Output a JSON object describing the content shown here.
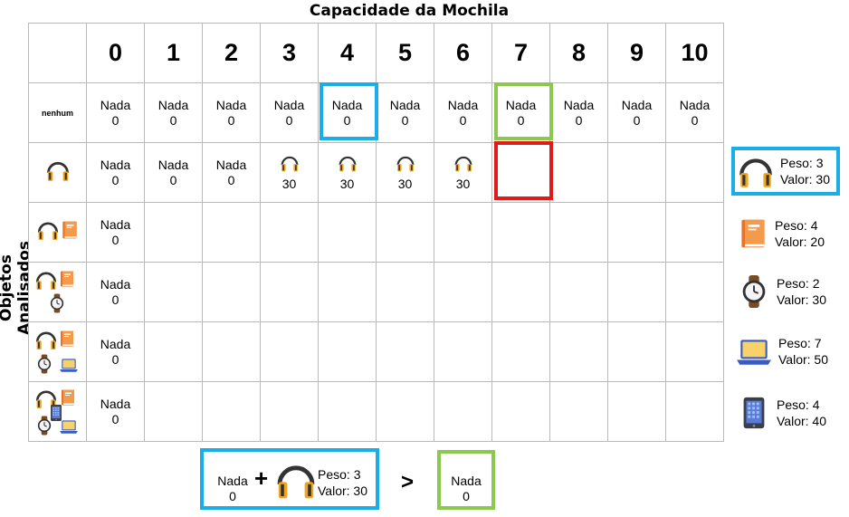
{
  "title": "Capacidade da Mochila",
  "y_axis_label": "Objetos Analisados",
  "capacities": [
    "0",
    "1",
    "2",
    "3",
    "4",
    "5",
    "6",
    "7",
    "8",
    "9",
    "10"
  ],
  "rows": [
    {
      "label": "nenhum",
      "cells": [
        {
          "text": "Nada",
          "value": "0"
        },
        {
          "text": "Nada",
          "value": "0"
        },
        {
          "text": "Nada",
          "value": "0"
        },
        {
          "text": "Nada",
          "value": "0"
        },
        {
          "text": "Nada",
          "value": "0"
        },
        {
          "text": "Nada",
          "value": "0"
        },
        {
          "text": "Nada",
          "value": "0"
        },
        {
          "text": "Nada",
          "value": "0"
        },
        {
          "text": "Nada",
          "value": "0"
        },
        {
          "text": "Nada",
          "value": "0"
        },
        {
          "text": "Nada",
          "value": "0"
        }
      ]
    },
    {
      "label": "",
      "cells": [
        {
          "text": "Nada",
          "value": "0"
        },
        {
          "text": "Nada",
          "value": "0"
        },
        {
          "text": "Nada",
          "value": "0"
        },
        {
          "icon": "headphones-icon",
          "value": "30"
        },
        {
          "icon": "headphones-icon",
          "value": "30"
        },
        {
          "icon": "headphones-icon",
          "value": "30"
        },
        {
          "icon": "headphones-icon",
          "value": "30"
        },
        {},
        {},
        {},
        {}
      ]
    },
    {
      "label": "",
      "cells": [
        {
          "text": "Nada",
          "value": "0"
        },
        {},
        {},
        {},
        {},
        {},
        {},
        {},
        {},
        {},
        {}
      ]
    },
    {
      "label": "",
      "cells": [
        {
          "text": "Nada",
          "value": "0"
        },
        {},
        {},
        {},
        {},
        {},
        {},
        {},
        {},
        {},
        {}
      ]
    },
    {
      "label": "",
      "cells": [
        {
          "text": "Nada",
          "value": "0"
        },
        {},
        {},
        {},
        {},
        {},
        {},
        {},
        {},
        {},
        {}
      ]
    },
    {
      "label": "",
      "cells": [
        {
          "text": "Nada",
          "value": "0"
        },
        {},
        {},
        {},
        {},
        {},
        {},
        {},
        {},
        {},
        {}
      ]
    }
  ],
  "items": [
    {
      "icon": "headphones-icon",
      "peso": "Peso: 3",
      "valor": "Valor: 30"
    },
    {
      "icon": "book-icon",
      "peso": "Peso: 4",
      "valor": "Valor: 20"
    },
    {
      "icon": "watch-icon",
      "peso": "Peso: 2",
      "valor": "Valor: 30"
    },
    {
      "icon": "laptop-icon",
      "peso": "Peso: 7",
      "valor": "Valor: 50"
    },
    {
      "icon": "tablet-icon",
      "peso": "Peso: 4",
      "valor": "Valor: 40"
    }
  ],
  "comparison": {
    "left_text": "Nada",
    "left_value": "0",
    "plus": "+",
    "item_peso": "Peso: 3",
    "item_valor": "Valor: 30",
    "operator": ">",
    "right_text": "Nada",
    "right_value": "0"
  },
  "colors": {
    "blue": "#1aaee8",
    "green": "#8cc850",
    "red": "#e01b1b",
    "orange": "#f29a1e",
    "grid": "#b9b9b9"
  }
}
